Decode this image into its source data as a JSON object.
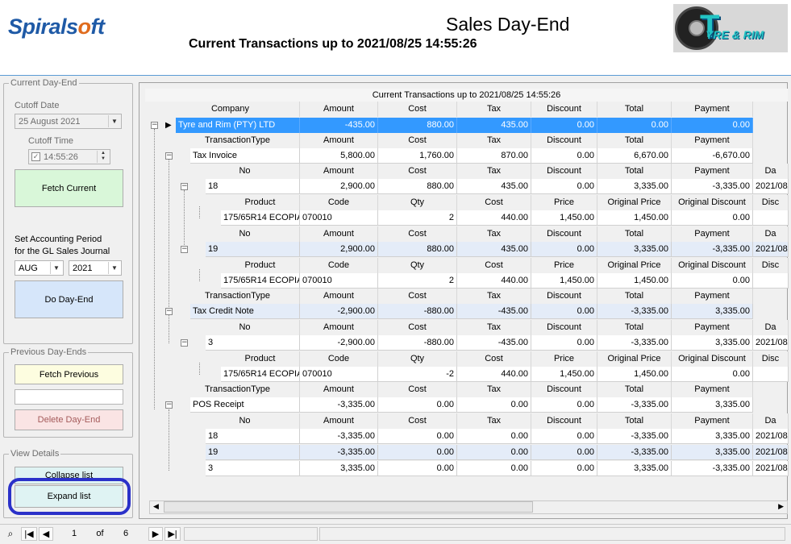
{
  "header": {
    "logo_a": "Spirals",
    "logo_o": "o",
    "logo_b": "ft",
    "title": "Sales Day-End",
    "subtitle": "Current Transactions up to  2021/08/25 14:55:26",
    "brand_text": "YRE & RIM",
    "brand_initial": "T"
  },
  "current_dayend": {
    "legend": "Current Day-End",
    "cutoff_date_label": "Cutoff Date",
    "cutoff_date_value": "25   August    2021",
    "cutoff_time_label": "Cutoff Time",
    "cutoff_time_value": "14:55:26",
    "fetch_current_label": "Fetch Current",
    "set_period_label_1": "Set Accounting  Period",
    "set_period_label_2": "for the GL Sales Journal",
    "month_value": "AUG",
    "year_value": "2021",
    "do_dayend_label": "Do Day-End"
  },
  "previous_dayends": {
    "legend": "Previous Day-Ends",
    "fetch_previous_label": "Fetch Previous",
    "previous_value": "",
    "delete_label": "Delete Day-End"
  },
  "view_details": {
    "legend": "View Details",
    "collapse_label": "Collapse list",
    "expand_label": "Expand list"
  },
  "grid": {
    "caption": "Current Transactions up to  2021/08/25 14:55:26",
    "company_headers": [
      "Company",
      "Amount",
      "Cost",
      "Tax",
      "Discount",
      "Total",
      "Payment"
    ],
    "company_row": [
      "Tyre and Rim (PTY) LTD",
      "-435.00",
      "880.00",
      "435.00",
      "0.00",
      "0.00",
      "0.00"
    ],
    "tt_headers": [
      "TransactionType",
      "Amount",
      "Cost",
      "Tax",
      "Discount",
      "Total",
      "Payment"
    ],
    "no_headers": [
      "No",
      "Amount",
      "Cost",
      "Tax",
      "Discount",
      "Total",
      "Payment",
      "Da"
    ],
    "prod_headers": [
      "Product",
      "Code",
      "Qty",
      "Cost",
      "Price",
      "Original Price",
      "Original Discount",
      "Disc"
    ],
    "tax_invoice": [
      "Tax Invoice",
      "5,800.00",
      "1,760.00",
      "870.00",
      "0.00",
      "6,670.00",
      "-6,670.00"
    ],
    "ti_row18": [
      "18",
      "2,900.00",
      "880.00",
      "435.00",
      "0.00",
      "3,335.00",
      "-3,335.00",
      "2021/08/"
    ],
    "ti_prod18": [
      "175/65R14 ECOPIA",
      "070010",
      "2",
      "440.00",
      "1,450.00",
      "1,450.00",
      "0.00",
      ""
    ],
    "ti_row19": [
      "19",
      "2,900.00",
      "880.00",
      "435.00",
      "0.00",
      "3,335.00",
      "-3,335.00",
      "2021/08/"
    ],
    "ti_prod19": [
      "175/65R14 ECOPIA",
      "070010",
      "2",
      "440.00",
      "1,450.00",
      "1,450.00",
      "0.00",
      ""
    ],
    "tax_credit": [
      "Tax Credit Note",
      "-2,900.00",
      "-880.00",
      "-435.00",
      "0.00",
      "-3,335.00",
      "3,335.00"
    ],
    "tc_row3": [
      "3",
      "-2,900.00",
      "-880.00",
      "-435.00",
      "0.00",
      "-3,335.00",
      "3,335.00",
      "2021/08/"
    ],
    "tc_prod3": [
      "175/65R14 ECOPIA",
      "070010",
      "-2",
      "440.00",
      "1,450.00",
      "1,450.00",
      "0.00",
      ""
    ],
    "pos_receipt": [
      "POS Receipt",
      "-3,335.00",
      "0.00",
      "0.00",
      "0.00",
      "-3,335.00",
      "3,335.00"
    ],
    "pos_row18": [
      "18",
      "-3,335.00",
      "0.00",
      "0.00",
      "0.00",
      "-3,335.00",
      "3,335.00",
      "2021/08/"
    ],
    "pos_row19": [
      "19",
      "-3,335.00",
      "0.00",
      "0.00",
      "0.00",
      "-3,335.00",
      "3,335.00",
      "2021/08/"
    ],
    "pos_row3": [
      "3",
      "3,335.00",
      "0.00",
      "0.00",
      "0.00",
      "3,335.00",
      "-3,335.00",
      "2021/08/"
    ]
  },
  "navigator": {
    "page": "1",
    "of_label": "of",
    "total_pages": "6"
  },
  "colors": {
    "selection": "#3399ff",
    "highlight_ring": "#2b31c9",
    "brand_blue": "#1f5aa6",
    "brand_orange": "#e06c1e"
  }
}
